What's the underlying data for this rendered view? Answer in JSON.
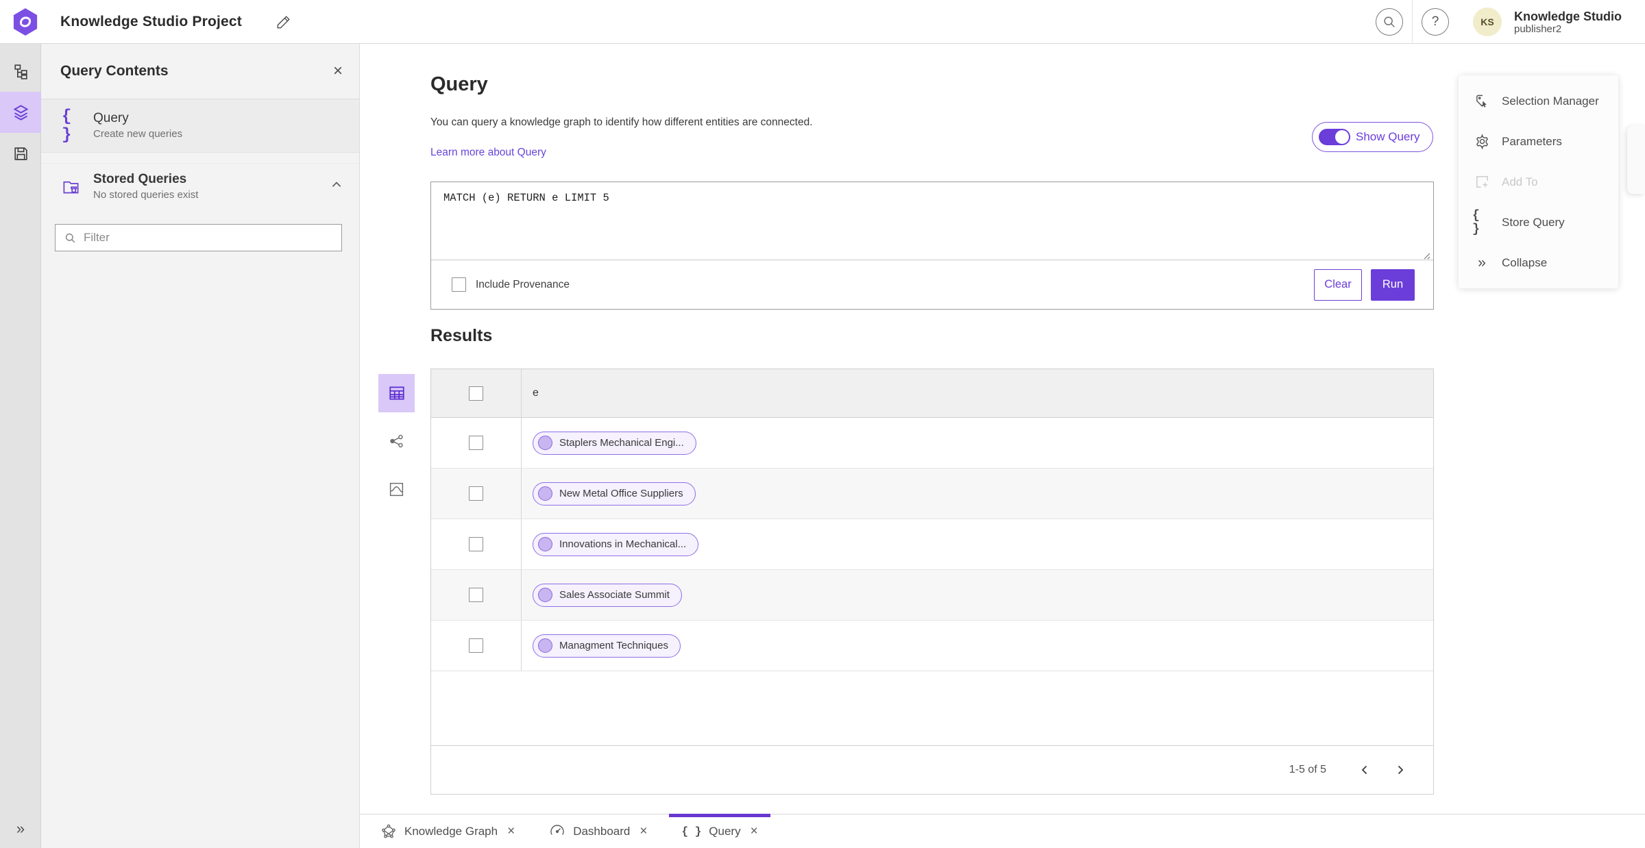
{
  "header": {
    "title": "Knowledge Studio Project",
    "user_name": "Knowledge Studio",
    "user_role": "publisher2",
    "avatar_initials": "KS",
    "help_glyph": "?"
  },
  "left_panel": {
    "title": "Query Contents",
    "close_glyph": "×",
    "query_item": {
      "label": "Query",
      "description": "Create new queries"
    },
    "stored_item": {
      "label": "Stored Queries",
      "description": "No stored queries exist"
    },
    "filter_placeholder": "Filter"
  },
  "query_section": {
    "heading": "Query",
    "description": "You can query a knowledge graph to identify how different entities are connected.",
    "learn_more": "Learn more about Query",
    "show_query_label": "Show Query",
    "query_text": "MATCH (e) RETURN e LIMIT 5",
    "include_provenance_label": "Include Provenance",
    "clear_label": "Clear",
    "run_label": "Run"
  },
  "results": {
    "heading": "Results",
    "column_header": "e",
    "rows": [
      {
        "label": "Staplers Mechanical Engi..."
      },
      {
        "label": "New Metal Office Suppliers"
      },
      {
        "label": "Innovations in Mechanical..."
      },
      {
        "label": "Sales Associate Summit"
      },
      {
        "label": "Managment Techniques"
      }
    ],
    "pagination": {
      "range_label": "1-5 of 5"
    }
  },
  "right_menu": {
    "items": [
      {
        "label": "Selection Manager"
      },
      {
        "label": "Parameters"
      },
      {
        "label": "Add To"
      },
      {
        "label": "Store Query"
      },
      {
        "label": "Collapse"
      }
    ],
    "braces_glyph": "{ }",
    "collapse_glyph": "»"
  },
  "bottom_tabs": [
    {
      "label": "Knowledge Graph"
    },
    {
      "label": "Dashboard"
    },
    {
      "label": "Query"
    }
  ],
  "misc": {
    "expand_glyph": "»",
    "tab_close_glyph": "×",
    "braces_glyph": "{ }"
  },
  "colors": {
    "primary_purple": "#6b3dd9",
    "active_highlight": "#d9c8f8",
    "pill_border": "#8f6fe6",
    "pill_background": "#f5f1fd",
    "link": "#6945d8",
    "avatar_background": "#f1ecca",
    "active_tab_indicator": "#6a35d0"
  }
}
